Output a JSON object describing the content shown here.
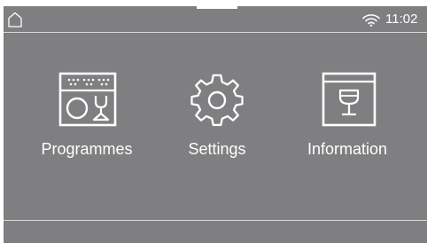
{
  "status_bar": {
    "time": "11:02",
    "home_icon": "home-icon",
    "wifi_icon": "wifi-icon"
  },
  "menu": {
    "items": [
      {
        "label": "Programmes",
        "icon": "dishwasher-programmes-icon"
      },
      {
        "label": "Settings",
        "icon": "gear-icon"
      },
      {
        "label": "Information",
        "icon": "information-glass-icon"
      }
    ]
  },
  "colors": {
    "background": "#7f7f81",
    "foreground": "#ffffff",
    "divider": "#d9d9da"
  }
}
